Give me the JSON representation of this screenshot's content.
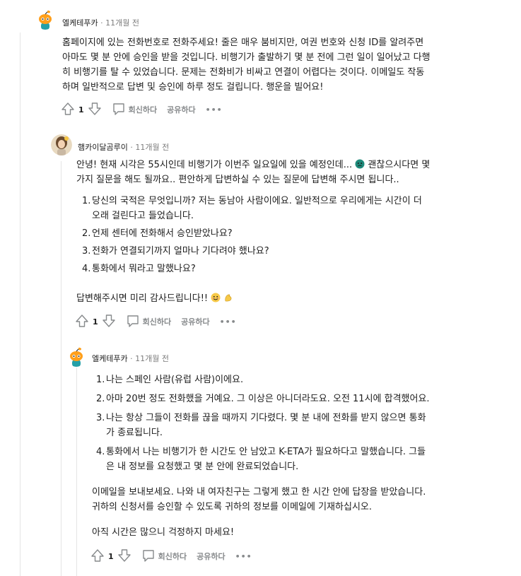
{
  "comments": [
    {
      "author": "엘케테푸카",
      "separator": "·",
      "time": "11개월 전",
      "body": [
        "홈페이지에 있는 전화번호로 전화주세요! 줄은 매우 붐비지만, 여권 번호와 신청 ID를 알려주면",
        "아마도 몇 분 안에 승인을 받을 것입니다. 비행기가 출발하기 몇 분 전에 그런 일이 일어났고 다행",
        "히 비행기를 탈 수 있었습니다. 문제는 전화비가 비싸고 연결이 어렵다는 것이다. 이메일도 작동",
        "하며 일반적으로 답변 및 승인에 하루 정도 걸립니다. 행운을 빌어요!"
      ],
      "votes": "1",
      "reply_label": "회신하다",
      "share_label": "공유하다",
      "more_label": "•••"
    },
    {
      "author": "햄카이달곰루이",
      "separator": "·",
      "time": "11개월 전",
      "intro": [
        "안녕! 현재 시각은 55시인데 비행기가 이번주 일요일에 있을 예정인데...",
        "괜찮으시다면 몇",
        "가지 질문을 해도 될까요.. 편안하게 답변하실 수 있는 질문에 답변해 주시면 됩니다.."
      ],
      "list": [
        [
          "1.",
          "당신의 국적은 무엇입니까? 저는 동남아 사람이에요. 일반적으로 우리에게는 시간이 더",
          "오래 걸린다고 들었습니다."
        ],
        [
          "2.",
          "언제 센터에 전화해서 승인받았나요?"
        ],
        [
          "3.",
          "전화가 연결되기까지 얼마나 기다려야 했나요?"
        ],
        [
          "4.",
          "통화에서 뭐라고 말했나요?"
        ]
      ],
      "closing": "답변해주시면 미리 감사드립니다!!",
      "votes": "1",
      "reply_label": "회신하다",
      "share_label": "공유하다",
      "more_label": "•••"
    },
    {
      "author": "엘케테푸카",
      "separator": "·",
      "time": "11개월 전",
      "list": [
        [
          "1.",
          "나는 스페인 사람(유럽 사람)이에요."
        ],
        [
          "2.",
          "아마 20번 정도 전화했을 거예요. 그 이상은 아니더라도요. 오전 11시에 합격했어요."
        ],
        [
          "3.",
          "나는 항상 그들이 전화를 끊을 때까지 기다렸다. 몇 분 내에 전화를 받지 않으면 통화",
          "가 종료됩니다."
        ],
        [
          "4.",
          "통화에서 나는 비행기가 한 시간도 안 남았고 K-ETA가 필요하다고 말했습니다. 그들",
          "은 내 정보를 요청했고 몇 분 안에 완료되었습니다."
        ]
      ],
      "para1": [
        "이메일을 보내보세요. 나와 내 여자친구는 그렇게 했고 한 시간 안에 답장을 받았습니다.",
        "귀하의 신청서를 승인할 수 있도록 귀하의 정보를 이메일에 기재하십시오."
      ],
      "para2": "아직 시간은 많으니 걱정하지 마세요!",
      "votes": "1",
      "reply_label": "회신하다",
      "share_label": "공유하다",
      "more_label": "•••"
    }
  ],
  "icons": {
    "avatar_1": "reddit-snoo-avatar",
    "avatar_2": "user-photo-avatar",
    "upvote": "arrow-up-icon",
    "downvote": "arrow-down-icon",
    "reply": "speech-bubble-icon",
    "emoji_cry": "crying-face-emoji",
    "emoji_smile": "smiling-face-emoji",
    "emoji_flex": "flexed-biceps-emoji"
  },
  "colors": {
    "text": "#1c1c1c",
    "meta": "#7c7c7c",
    "action": "#878a8c",
    "thread_line": "#e5e5e5",
    "snoo_orange": "#ff9f1a",
    "snoo_teal": "#24a0a8"
  }
}
